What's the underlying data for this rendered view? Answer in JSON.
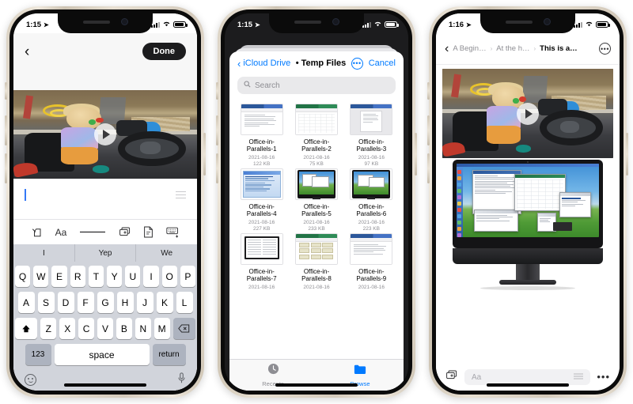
{
  "phones": {
    "notes_editor": {
      "status_bar": {
        "time": "1:15",
        "location_icon": "location-arrow-icon",
        "cellular_icon": "cellular-bars-icon",
        "wifi_icon": "wifi-icon",
        "battery_icon": "battery-icon"
      },
      "nav": {
        "back_icon": "chevron-left-icon",
        "done_label": "Done"
      },
      "attachment": {
        "type": "video-thumbnail",
        "play_icon": "play-icon"
      },
      "toolbar": [
        {
          "name": "markup-pen-icon",
          "glyph": "markup"
        },
        {
          "name": "text-format-icon",
          "glyph": "Aa"
        },
        {
          "name": "divider-line-icon",
          "glyph": "line"
        },
        {
          "name": "add-media-icon",
          "glyph": "media-plus"
        },
        {
          "name": "scan-document-icon",
          "glyph": "scan"
        },
        {
          "name": "hide-keyboard-icon",
          "glyph": "keyboard-down"
        }
      ],
      "keyboard": {
        "predictions": [
          "I",
          "Yep",
          "We"
        ],
        "row1": [
          "Q",
          "W",
          "E",
          "R",
          "T",
          "Y",
          "U",
          "I",
          "O",
          "P"
        ],
        "row2": [
          "A",
          "S",
          "D",
          "F",
          "G",
          "H",
          "J",
          "K",
          "L"
        ],
        "row3": [
          "Z",
          "X",
          "C",
          "V",
          "B",
          "N",
          "M"
        ],
        "shift_icon": "shift-up-icon",
        "delete_icon": "backspace-icon",
        "numbers_label": "123",
        "space_label": "space",
        "return_label": "return",
        "emoji_icon": "emoji-face-icon",
        "dictation_icon": "microphone-icon"
      }
    },
    "files_picker": {
      "status_bar": {
        "time": "1:15",
        "location_icon": "location-arrow-icon",
        "cellular_icon": "cellular-bars-icon",
        "wifi_icon": "wifi-icon",
        "battery_icon": "battery-icon"
      },
      "nav": {
        "back_icon": "chevron-left-icon",
        "back_label": "iCloud Drive",
        "title": "• Temp Files",
        "more_icon": "ellipsis-circle-icon",
        "cancel_label": "Cancel"
      },
      "search": {
        "icon": "search-icon",
        "placeholder": "Search",
        "value": ""
      },
      "files": [
        {
          "name": "Office-in-Parallels-1",
          "date": "2021-08-16",
          "size": "122 KB",
          "thumb": "word-doc"
        },
        {
          "name": "Office-in-Parallels-2",
          "date": "2021-08-16",
          "size": "75 KB",
          "thumb": "excel-sheet"
        },
        {
          "name": "Office-in-Parallels-3",
          "date": "2021-08-16",
          "size": "97 KB",
          "thumb": "word-page"
        },
        {
          "name": "Office-in-Parallels-4",
          "date": "2021-08-16",
          "size": "227 KB",
          "thumb": "dialog-blue"
        },
        {
          "name": "Office-in-Parallels-5",
          "date": "2021-08-16",
          "size": "233 KB",
          "thumb": "imac-desktop"
        },
        {
          "name": "Office-in-Parallels-6",
          "date": "2021-08-16",
          "size": "223 KB",
          "thumb": "imac-desktop"
        },
        {
          "name": "Office-in-Parallels-7",
          "date": "2021-08-16",
          "size": "",
          "thumb": "laptop-doc"
        },
        {
          "name": "Office-in-Parallels-8",
          "date": "2021-08-16",
          "size": "",
          "thumb": "ppt-slides"
        },
        {
          "name": "Office-in-Parallels-9",
          "date": "2021-08-16",
          "size": "",
          "thumb": "word-page"
        }
      ],
      "tabs": [
        {
          "label": "Recents",
          "icon": "clock-icon",
          "selected": false
        },
        {
          "label": "Browse",
          "icon": "folder-icon",
          "selected": true
        }
      ]
    },
    "note_viewer": {
      "status_bar": {
        "time": "1:16",
        "location_icon": "location-arrow-icon",
        "cellular_icon": "cellular-bars-icon",
        "wifi_icon": "wifi-icon",
        "battery_icon": "battery-icon"
      },
      "nav": {
        "back_icon": "chevron-left-icon",
        "breadcrumbs": [
          "A Begin…",
          "At the h…",
          "This is a…"
        ],
        "separator": "›",
        "more_icon": "ellipsis-circle-icon"
      },
      "attachment": {
        "type": "video-thumbnail",
        "play_icon": "play-icon"
      },
      "screenshot": {
        "type": "imac-desktop-screenshot"
      },
      "toolbar": {
        "add_media_icon": "add-media-icon",
        "format_placeholder": "Aa",
        "list_icon": "list-lines-icon",
        "more_icon": "ellipsis-icon"
      }
    }
  },
  "colors": {
    "ios_blue": "#007aff",
    "keyboard_bg": "#d1d4db",
    "key_bg": "#ffffff",
    "key_alt_bg": "#adb3bf",
    "done_pill_bg": "#1c1c1e",
    "secondary_text": "#8e8e93",
    "sheet_dim": "#1c1c1e"
  }
}
